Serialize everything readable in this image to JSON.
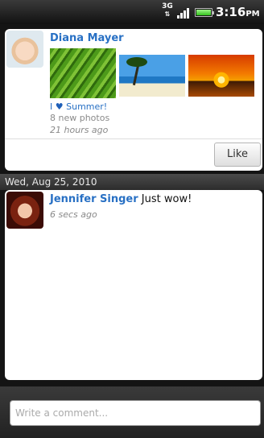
{
  "status_bar": {
    "network": "3G",
    "network_arrows": "⇅",
    "time": "3:16",
    "ampm": "PM",
    "battery_level": 1.0,
    "signal_bars": 4
  },
  "feed": {
    "post1": {
      "name": "Diana Mayer",
      "caption_prefix": "I",
      "heart": "♥",
      "caption_suffix": "Summer!",
      "photos_count_text": "8 new photos",
      "time": "21 hours ago",
      "like_label": "Like"
    },
    "date_header": "Wed, Aug 25, 2010",
    "post2": {
      "name": "Jennifer Singer",
      "text": "Just wow!",
      "time": "6 secs ago"
    }
  },
  "comment": {
    "placeholder": "Write a comment...",
    "value": ""
  }
}
